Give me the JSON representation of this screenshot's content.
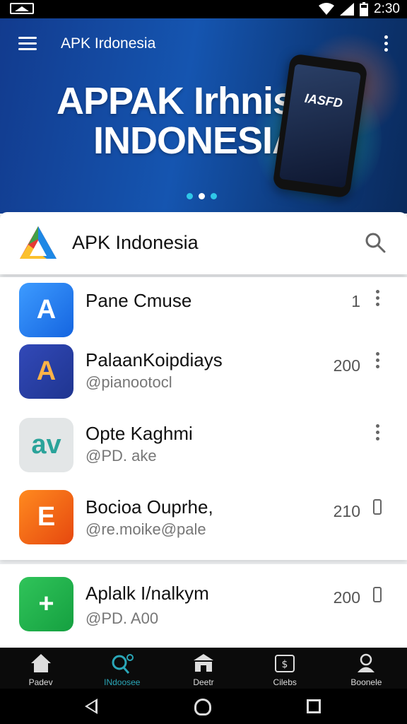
{
  "status_bar": {
    "time": "2:30"
  },
  "header": {
    "title": "APK Irdonesia",
    "banner_line1": "APPAK Irhnisa",
    "banner_line2": "INDONESIA",
    "phone_screen_text": "IASFD",
    "carousel_count": 3,
    "carousel_active_index": 1
  },
  "search_bar": {
    "title": "APK Indonesia"
  },
  "app_list": [
    {
      "name": "Pane Cmuse",
      "subtitle": "",
      "count": "1",
      "action": "more",
      "icon_text": "A",
      "icon_color": "#1e7cf0"
    },
    {
      "name": "PalaanKoipdiays",
      "subtitle": "@pianootocl",
      "count": "200",
      "action": "more",
      "icon_text": "A",
      "icon_color": "#2747a8"
    },
    {
      "name": "Opte Kaghmi",
      "subtitle": "@PD. ake",
      "count": "",
      "action": "more",
      "icon_text": "av",
      "icon_color": "#e3e5e6"
    },
    {
      "name": "Bocioa Ouprhe,",
      "subtitle": "@re.moike@pale",
      "count": "210",
      "action": "delete",
      "icon_text": "E",
      "icon_color": "#f06b14"
    }
  ],
  "app_list_2": [
    {
      "name": "Aplalk I/nalkym",
      "subtitle": "@PD. A00",
      "count": "200",
      "action": "delete",
      "icon_text": "+",
      "icon_color": "#1fb24a"
    }
  ],
  "bottom_nav": [
    {
      "label": "Padev",
      "icon": "home-icon"
    },
    {
      "label": "INdoosee",
      "icon": "search-apps-icon",
      "active": true
    },
    {
      "label": "Deetr",
      "icon": "store-icon"
    },
    {
      "label": "Cilebs",
      "icon": "wallet-icon"
    },
    {
      "label": "Boonele",
      "icon": "profile-icon"
    }
  ]
}
